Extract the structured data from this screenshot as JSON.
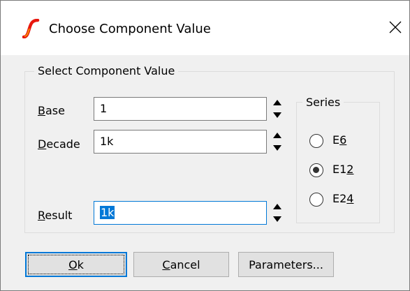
{
  "window": {
    "title": "Choose Component Value",
    "icon": "ltspice-icon",
    "accent": "#0078d7"
  },
  "group": {
    "title": "Select Component Value"
  },
  "fields": {
    "base": {
      "label_key": "B",
      "label_rest": "ase",
      "value": "1"
    },
    "decade": {
      "label_key": "D",
      "label_rest": "ecade",
      "value": "1k"
    },
    "result": {
      "label_key": "R",
      "label_rest": "esult",
      "value": "1k"
    }
  },
  "series": {
    "title": "Series",
    "options": [
      {
        "pre": "E",
        "key": "6",
        "post": "",
        "checked": false
      },
      {
        "pre": "E1",
        "key": "2",
        "post": "",
        "checked": true
      },
      {
        "pre": "E2",
        "key": "4",
        "post": "",
        "checked": false
      }
    ]
  },
  "buttons": {
    "ok": {
      "key": "O",
      "rest": "k"
    },
    "cancel": {
      "key": "C",
      "rest": "ancel"
    },
    "parameters": "Parameters..."
  }
}
